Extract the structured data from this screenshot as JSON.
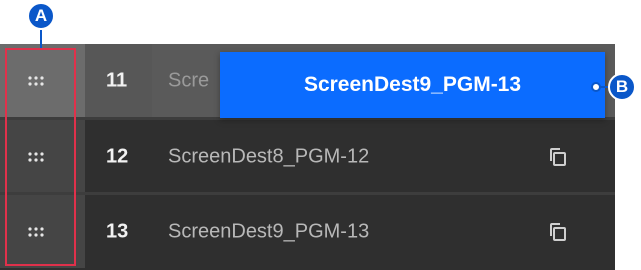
{
  "rows": [
    {
      "number": "11",
      "name": "Scre"
    },
    {
      "number": "12",
      "name": "ScreenDest8_PGM-12"
    },
    {
      "number": "13",
      "name": "ScreenDest9_PGM-13"
    }
  ],
  "drag_ghost": {
    "label": "ScreenDest9_PGM-13"
  },
  "callouts": {
    "a": "A",
    "b": "B"
  },
  "icons": {
    "drag_handle": "drag-handle-icon",
    "copy": "copy-icon"
  },
  "colors": {
    "ghost": "#0b6cff",
    "highlight": "#e0314b",
    "callout": "#0a57c9"
  }
}
